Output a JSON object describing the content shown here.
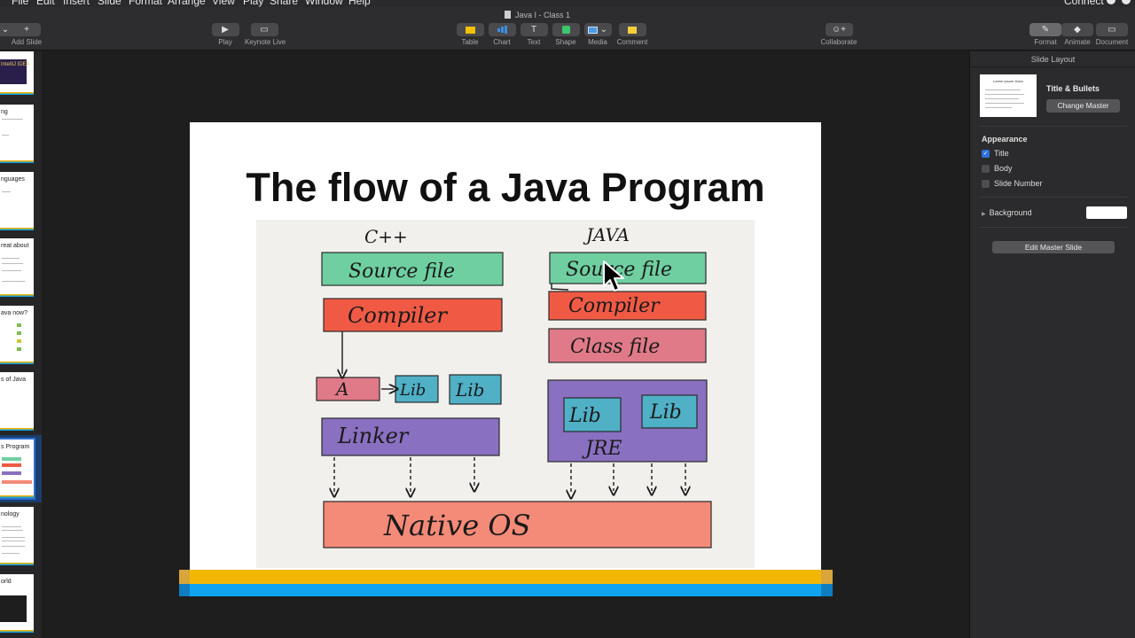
{
  "menubar": {
    "items": [
      "File",
      "Edit",
      "Insert",
      "Slide",
      "Format",
      "Arrange",
      "View",
      "Play",
      "Share",
      "Window",
      "Help"
    ],
    "connect": "Connect"
  },
  "window": {
    "title": "Java I - Class 1"
  },
  "toolbar": {
    "add_slide": "Add Slide",
    "play": "Play",
    "keynote_live": "Keynote Live",
    "table": "Table",
    "chart": "Chart",
    "text": "Text",
    "shape": "Shape",
    "media": "Media",
    "comment": "Comment",
    "collaborate": "Collaborate",
    "format": "Format",
    "animate": "Animate",
    "document": "Document"
  },
  "navigator": {
    "slides": [
      {
        "title": "IntelliJ IDEA"
      },
      {
        "title": "ng"
      },
      {
        "title": "nguages"
      },
      {
        "title": "reat about"
      },
      {
        "title": "ava now?"
      },
      {
        "title": "s of Java"
      },
      {
        "title": "s Program"
      },
      {
        "title": "nology"
      },
      {
        "title": "orld"
      }
    ]
  },
  "slide": {
    "title": "The flow of a Java Program",
    "diagram": {
      "cpp_heading": "C++",
      "java_heading": "JAVA",
      "cpp_source": "Source file",
      "cpp_compiler": "Compiler",
      "cpp_a": "A",
      "cpp_lib1": "Lib",
      "cpp_lib2": "Lib",
      "cpp_linker": "Linker",
      "java_source": "Source file",
      "java_compiler": "Compiler",
      "java_class": "Class file",
      "java_lib1": "Lib",
      "java_lib2": "Lib",
      "java_jre": "JRE",
      "native_os": "Native OS"
    },
    "colors": {
      "green": "#6fcfa0",
      "red": "#f05a45",
      "pink": "#e07a88",
      "teal": "#4fb0c6",
      "purple": "#8a70c0",
      "salmon": "#f48a78",
      "stripe_yellow": "#f2b705",
      "stripe_blue": "#10a4f0"
    }
  },
  "inspector": {
    "header": "Slide Layout",
    "layout_thumb_title": "Lorem Ipsum Dolor",
    "layout_name": "Title & Bullets",
    "change_master": "Change Master",
    "appearance_label": "Appearance",
    "appearance": [
      {
        "label": "Title",
        "checked": true
      },
      {
        "label": "Body",
        "checked": false
      },
      {
        "label": "Slide Number",
        "checked": false
      }
    ],
    "background_label": "Background",
    "edit_master": "Edit Master Slide"
  }
}
